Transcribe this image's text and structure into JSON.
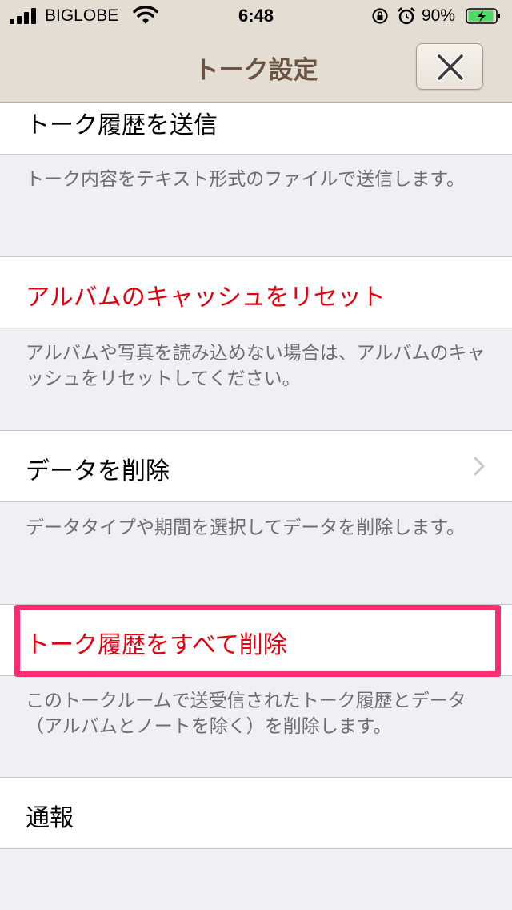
{
  "status_bar": {
    "carrier": "BIGLOBE",
    "time": "6:48",
    "battery_percent": "90%",
    "icons": [
      "signal-icon",
      "wifi-icon",
      "orientation-lock-icon",
      "alarm-icon",
      "battery-charging-icon"
    ]
  },
  "nav": {
    "title": "トーク設定",
    "close_icon": "close-icon"
  },
  "sections": [
    {
      "label": "トーク履歴を送信",
      "style": "normal",
      "description": "トーク内容をテキスト形式のファイルで送信します。"
    },
    {
      "label": "アルバムのキャッシュをリセット",
      "style": "destructive",
      "description": "アルバムや写真を読み込めない場合は、アルバムのキャッシュをリセットしてください。"
    },
    {
      "label": "データを削除",
      "style": "normal",
      "accessory": "chevron-right-icon",
      "description": "データタイプや期間を選択してデータを削除します。"
    },
    {
      "label": "トーク履歴をすべて削除",
      "style": "destructive",
      "highlighted": true,
      "description": "このトークルームで送受信されたトーク履歴とデータ（アルバムとノートを除く）を削除します。"
    },
    {
      "label": "通報",
      "style": "normal"
    }
  ],
  "colors": {
    "header_bg": "#e4ddd3",
    "title": "#6b5444",
    "destructive": "#e3000f",
    "highlight_box": "#ff2d6f",
    "grouped_bg": "#efeff4"
  }
}
